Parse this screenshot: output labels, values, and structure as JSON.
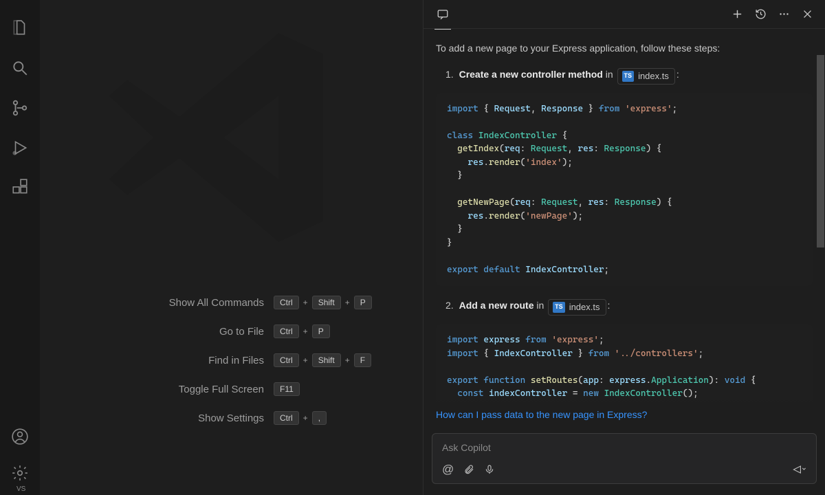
{
  "activity_bar": {
    "icons": [
      "files",
      "search",
      "source-control",
      "run-debug",
      "extensions"
    ],
    "bottom": [
      "accounts",
      "manage"
    ],
    "badge": "vs"
  },
  "welcome": {
    "shortcuts": [
      {
        "label": "Show All Commands",
        "keys": [
          "Ctrl",
          "Shift",
          "P"
        ]
      },
      {
        "label": "Go to File",
        "keys": [
          "Ctrl",
          "P"
        ]
      },
      {
        "label": "Find in Files",
        "keys": [
          "Ctrl",
          "Shift",
          "F"
        ]
      },
      {
        "label": "Toggle Full Screen",
        "keys": [
          "F11"
        ]
      },
      {
        "label": "Show Settings",
        "keys": [
          "Ctrl",
          ","
        ]
      }
    ]
  },
  "chat": {
    "intro": "To add a new page to your Express application, follow these steps:",
    "step1_num": "1.",
    "step1_bold": "Create a new controller method",
    "step1_tail": "in",
    "file_badge": "TS",
    "file_name": "index.ts",
    "colon": ":",
    "step2_num": "2.",
    "step2_bold": "Add a new route",
    "step2_tail": "in",
    "suggestion": "How can I pass data to the new page in Express?",
    "input_placeholder": "Ask Copilot",
    "input_icons": {
      "agent": "@",
      "attach": "attach",
      "voice": "mic",
      "send": "send-dropdown"
    },
    "code1": {
      "l1": {
        "import": "import",
        "braces_open": " { ",
        "req": "Request",
        "comma": ", ",
        "res": "Response",
        "braces_close": " } ",
        "from": "from",
        "sp": " ",
        "mod": "'express'",
        "semi": ";"
      },
      "l2": "",
      "l3": {
        "kw": "class",
        "sp": " ",
        "name": "IndexController",
        "brace": " {"
      },
      "l4": {
        "indent": "  ",
        "fn": "getIndex",
        "open": "(",
        "p1": "req",
        "colon1": ": ",
        "t1": "Request",
        "c1": ", ",
        "p2": "res",
        "colon2": ": ",
        "t2": "Response",
        "close": ") {"
      },
      "l5": {
        "indent": "    ",
        "obj": "res",
        "dot": ".",
        "fn": "render",
        "op": "(",
        "str": "'index'",
        "cl": ");"
      },
      "l6": {
        "indent": "  ",
        "brace": "}"
      },
      "l7": "",
      "l8": {
        "indent": "  ",
        "fn": "getNewPage",
        "open": "(",
        "p1": "req",
        "colon1": ": ",
        "t1": "Request",
        "c1": ", ",
        "p2": "res",
        "colon2": ": ",
        "t2": "Response",
        "close": ") {"
      },
      "l9": {
        "indent": "    ",
        "obj": "res",
        "dot": ".",
        "fn": "render",
        "op": "(",
        "str": "'newPage'",
        "cl": ");"
      },
      "l10": {
        "indent": "  ",
        "brace": "}"
      },
      "l11": {
        "brace": "}"
      },
      "l12": "",
      "l13": {
        "kw1": "export",
        "sp1": " ",
        "kw2": "default",
        "sp2": " ",
        "name": "IndexController",
        "semi": ";"
      }
    },
    "code2": {
      "l1": {
        "kw": "import",
        "sp": " ",
        "name": "express",
        "sp2": " ",
        "from": "from",
        "sp3": " ",
        "mod": "'express'",
        "semi": ";"
      },
      "l2": {
        "kw": "import",
        "op": " { ",
        "name": "IndexController",
        "cl": " } ",
        "from": "from",
        "sp": " ",
        "mod": "'../controllers'",
        "semi": ";"
      },
      "l3": "",
      "l4": {
        "kw1": "export",
        "sp1": " ",
        "kw2": "function",
        "sp2": " ",
        "fn": "setRoutes",
        "op": "(",
        "p": "app",
        "colon": ": ",
        "t1": "express",
        "dot": ".",
        "t2": "Application",
        "cl": "): ",
        "ret": "void",
        "brace": " {"
      },
      "l5": {
        "indent": "  ",
        "kw": "const",
        "sp": " ",
        "v": "indexController",
        "eq": " = ",
        "new": "new",
        "sp2": " ",
        "cls": "IndexController",
        "call": "();"
      }
    },
    "toolbar": [
      "new-chat",
      "history",
      "more",
      "close"
    ]
  }
}
